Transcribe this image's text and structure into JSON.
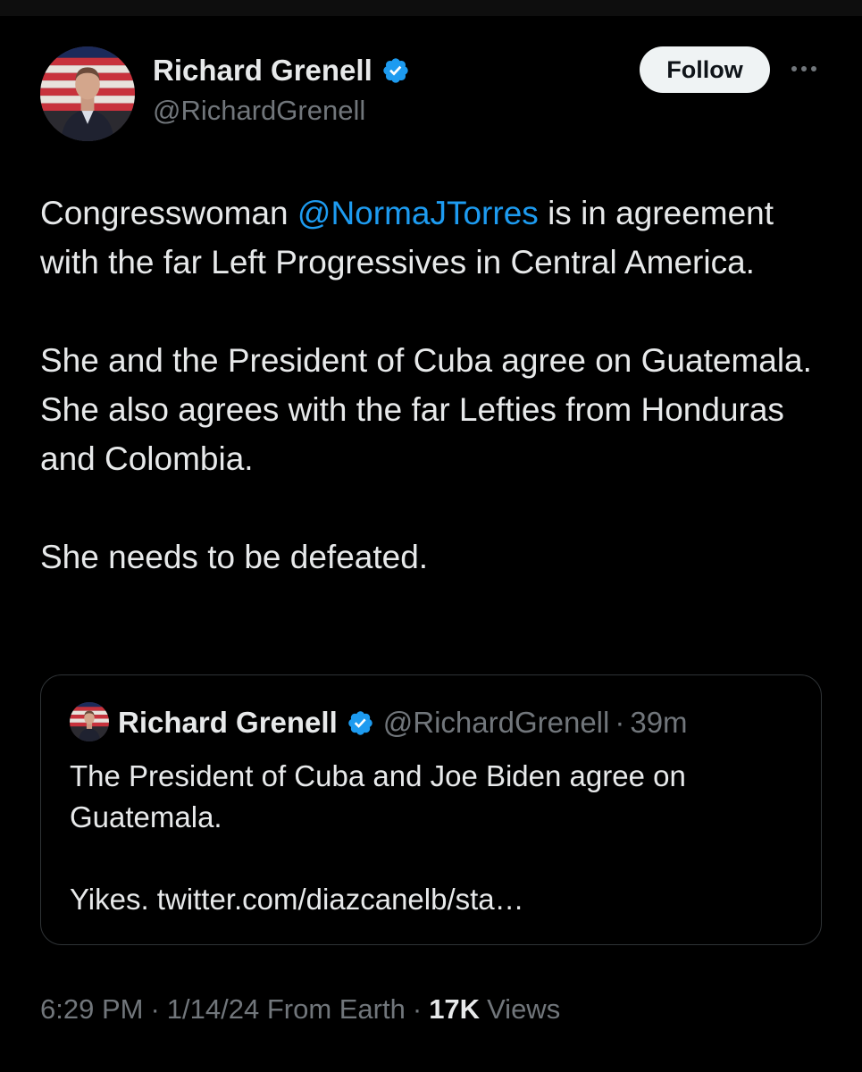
{
  "tweet": {
    "author": {
      "name": "Richard Grenell",
      "handle": "@RichardGrenell",
      "verified": true
    },
    "follow_label": "Follow",
    "body": {
      "p1_before": "Congresswoman ",
      "p1_mention": "@NormaJTorres",
      "p1_after": " is in agreement with the far Left Progressives in Central America.",
      "p2": "She and the President of Cuba agree on Guatemala. She also agrees with the far Lefties from Honduras and Colombia.",
      "p3": "She needs to be defeated."
    },
    "quote": {
      "author_name": "Richard Grenell",
      "handle": "@RichardGrenell",
      "separator": "·",
      "time": "39m",
      "p1": "The President of Cuba and Joe Biden agree on Guatemala.",
      "p2": "Yikes. twitter.com/diazcanelb/sta…"
    },
    "meta": {
      "time": "6:29 PM",
      "separator": "·",
      "date_source": "1/14/24 From Earth",
      "views_count": "17K",
      "views_label": "Views"
    }
  },
  "colors": {
    "background": "#000000",
    "text": "#e7e9ea",
    "secondary": "#71767b",
    "link": "#1d9bf0",
    "border": "#2f3336",
    "follow_bg": "#eff3f4"
  },
  "icons": {
    "verified": "verified-badge-icon",
    "more": "more-options-icon"
  }
}
